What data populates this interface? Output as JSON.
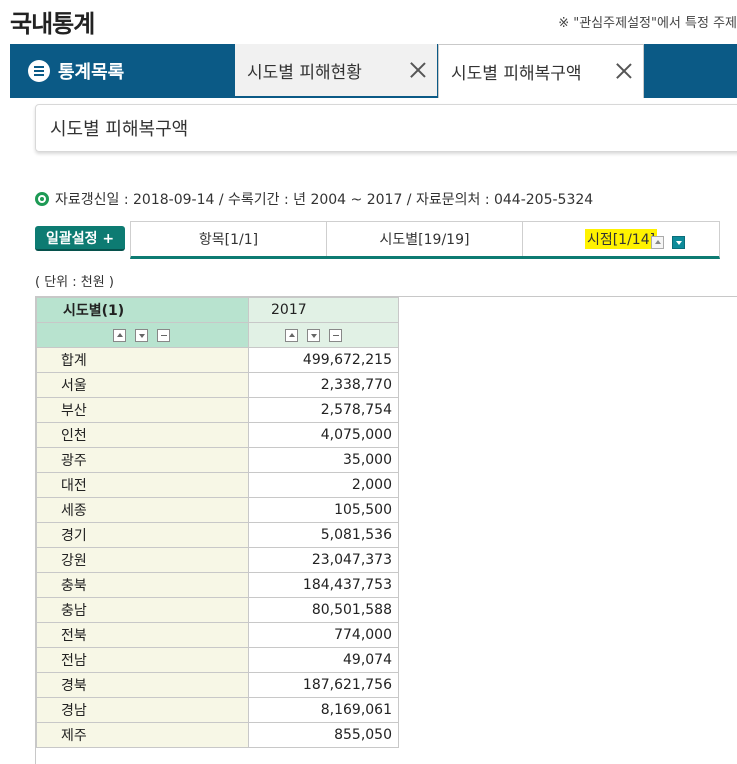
{
  "page": {
    "title": "국내통계",
    "note": "※ \"관심주제설정\"에서 특정 주제"
  },
  "tabs": {
    "catalog_label": "통계목록",
    "items": [
      {
        "label": "시도별 피해현황"
      },
      {
        "label": "시도별 피해복구액"
      }
    ]
  },
  "stat": {
    "title": "시도별 피해복구액",
    "info": "자료갱신일 : 2018-09-14 / 수록기간 : 년 2004 ~ 2017 / 자료문의처 : 044-205-5324"
  },
  "controls": {
    "set_all_label": "일괄설정 +",
    "dims": [
      {
        "label": "항목[1/1]"
      },
      {
        "label": "시도별[19/19]"
      },
      {
        "label": "시점[1/14]"
      }
    ],
    "unit_label": "( 단위 : 천원 )"
  },
  "table": {
    "headers": {
      "region": "시도별(1)",
      "year": "2017"
    },
    "rows": [
      {
        "region": "합계",
        "value": "499,672,215"
      },
      {
        "region": "서울",
        "value": "2,338,770"
      },
      {
        "region": "부산",
        "value": "2,578,754"
      },
      {
        "region": "인천",
        "value": "4,075,000"
      },
      {
        "region": "광주",
        "value": "35,000"
      },
      {
        "region": "대전",
        "value": "2,000"
      },
      {
        "region": "세종",
        "value": "105,500"
      },
      {
        "region": "경기",
        "value": "5,081,536"
      },
      {
        "region": "강원",
        "value": "23,047,373"
      },
      {
        "region": "충북",
        "value": "184,437,753"
      },
      {
        "region": "충남",
        "value": "80,501,588"
      },
      {
        "region": "전북",
        "value": "774,000"
      },
      {
        "region": "전남",
        "value": "49,074"
      },
      {
        "region": "경북",
        "value": "187,621,756"
      },
      {
        "region": "경남",
        "value": "8,169,061"
      },
      {
        "region": "제주",
        "value": "855,050"
      }
    ]
  },
  "colors": {
    "tabbar": "#0b5a86",
    "accent_teal": "#0d7b72",
    "highlight": "#fff200",
    "region_header": "#b8e3cf"
  }
}
